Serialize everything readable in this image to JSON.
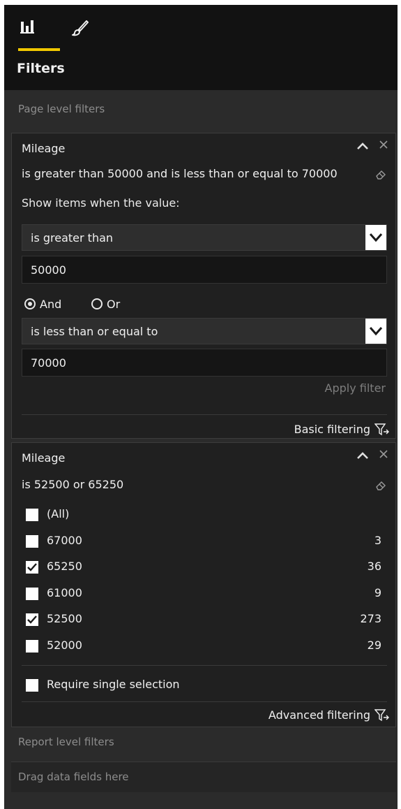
{
  "header": {
    "title": "Filters",
    "tabs": [
      {
        "icon": "bar-chart-icon",
        "active": true
      },
      {
        "icon": "paintbrush-icon",
        "active": false
      }
    ],
    "accent_color": "#f0c800"
  },
  "page_level": {
    "label": "Page level filters"
  },
  "advanced_card": {
    "field": "Mileage",
    "summary": "is greater than 50000 and is less than or equal to 70000",
    "show_items_label": "Show items when the value:",
    "condition1": {
      "operator": "is greater than",
      "value": "50000"
    },
    "logic": {
      "and_label": "And",
      "or_label": "Or",
      "selected": "And"
    },
    "condition2": {
      "operator": "is less than or equal to",
      "value": "70000"
    },
    "apply_label": "Apply filter",
    "switch_label": "Basic filtering"
  },
  "basic_card": {
    "field": "Mileage",
    "summary": "is 52500 or 65250",
    "items": [
      {
        "label": "(All)",
        "count": "",
        "checked": false
      },
      {
        "label": "67000",
        "count": "3",
        "checked": false
      },
      {
        "label": "65250",
        "count": "36",
        "checked": true
      },
      {
        "label": "61000",
        "count": "9",
        "checked": false
      },
      {
        "label": "52500",
        "count": "273",
        "checked": true
      },
      {
        "label": "52000",
        "count": "29",
        "checked": false
      }
    ],
    "require_single_label": "Require single selection",
    "require_single_checked": false,
    "switch_label": "Advanced filtering"
  },
  "report_level": {
    "label": "Report level filters",
    "placeholder": "Drag data fields here"
  }
}
